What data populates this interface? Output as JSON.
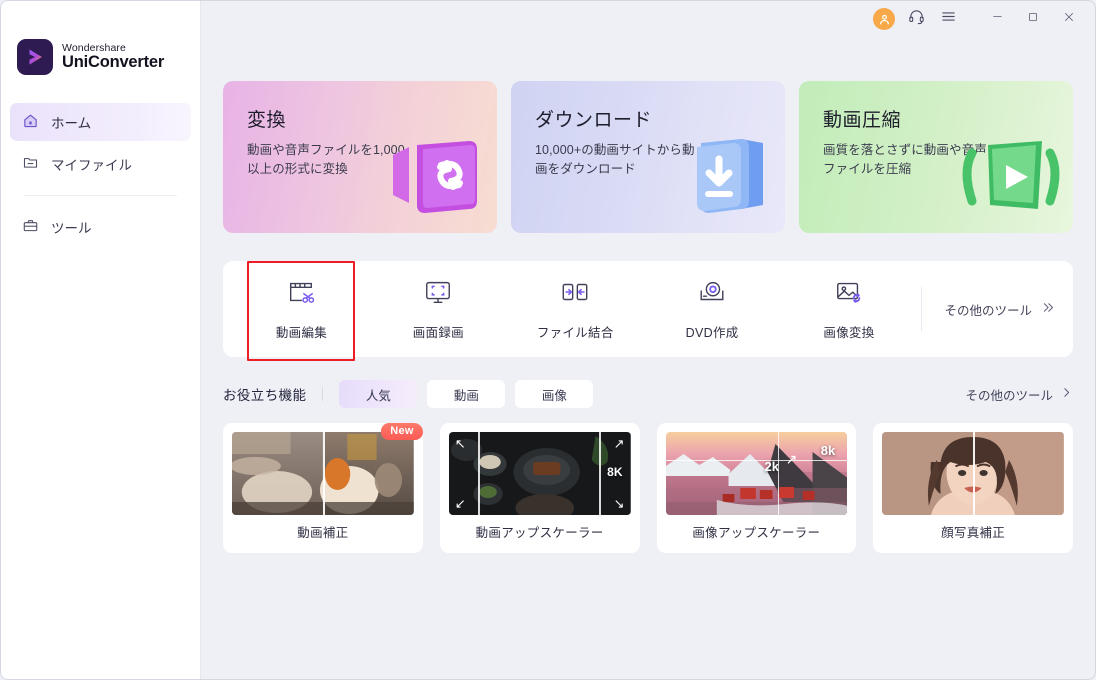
{
  "app": {
    "brand_line1": "Wondershare",
    "brand_line2": "UniConverter",
    "accent": "#7b5cf0",
    "highlight_border": "#ee1c25"
  },
  "titlebar": {
    "account_icon": "user-avatar-icon",
    "support_icon": "headset-icon",
    "menu_icon": "hamburger-menu-icon",
    "minimize_icon": "minimize-icon",
    "maximize_icon": "maximize-icon",
    "close_icon": "close-icon"
  },
  "sidebar": {
    "items": [
      {
        "label": "ホーム",
        "icon": "home-icon",
        "active": true
      },
      {
        "label": "マイファイル",
        "icon": "folder-icon",
        "active": false
      },
      {
        "label": "ツール",
        "icon": "toolbox-icon",
        "active": false
      }
    ]
  },
  "hero_cards": [
    {
      "title": "変換",
      "desc": "動画や音声ファイルを1,000以上の形式に変換",
      "icon": "convert-icon",
      "color_from": "#e8b3e6",
      "color_to": "#f7ddd1"
    },
    {
      "title": "ダウンロード",
      "desc": "10,000+の動画サイトから動画をダウンロード",
      "icon": "download-icon",
      "color_from": "#cfd3f2",
      "color_to": "#e9e8fa"
    },
    {
      "title": "動画圧縮",
      "desc": "画質を落とさずに動画や音声ファイルを圧縮",
      "icon": "compress-icon",
      "color_from": "#c2ecb9",
      "color_to": "#e8f6dd"
    }
  ],
  "tools": {
    "items": [
      {
        "label": "動画編集",
        "icon": "video-edit-icon",
        "selected": true
      },
      {
        "label": "画面録画",
        "icon": "screen-record-icon",
        "selected": false
      },
      {
        "label": "ファイル結合",
        "icon": "merge-files-icon",
        "selected": false
      },
      {
        "label": "DVD作成",
        "icon": "dvd-burn-icon",
        "selected": false
      },
      {
        "label": "画像変換",
        "icon": "image-convert-icon",
        "selected": false
      }
    ],
    "more_label": "その他のツール",
    "more_icon": "double-chevron-right-icon"
  },
  "filters": {
    "section_title": "お役立ち機能",
    "chips": [
      {
        "label": "人気",
        "active": true
      },
      {
        "label": "動画",
        "active": false
      },
      {
        "label": "画像",
        "active": false
      }
    ],
    "more_label": "その他のツール",
    "more_icon": "chevron-right-icon"
  },
  "features": [
    {
      "label": "動画補正",
      "badge": "New",
      "thumb": "dog-before-after-thumb"
    },
    {
      "label": "動画アップスケーラー",
      "badge": "",
      "thumb": "food-upscale-thumb",
      "tag": "8K"
    },
    {
      "label": "画像アップスケーラー",
      "badge": "",
      "thumb": "village-upscale-thumb",
      "tag_low": "2k",
      "tag_high": "8k"
    },
    {
      "label": "顔写真補正",
      "badge": "",
      "thumb": "portrait-before-after-thumb"
    }
  ]
}
